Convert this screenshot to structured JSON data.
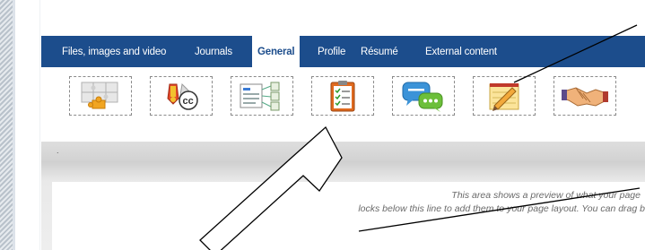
{
  "tabs": [
    {
      "label": "Files, images and video",
      "active": false
    },
    {
      "label": "Journals",
      "active": false
    },
    {
      "label": "General",
      "active": true
    },
    {
      "label": "Profile",
      "active": false
    },
    {
      "label": "Résumé",
      "active": false
    },
    {
      "label": "External content",
      "active": false
    }
  ],
  "blocks": [
    {
      "icon": "puzzle-pieces-icon"
    },
    {
      "icon": "creative-commons-license-icon"
    },
    {
      "icon": "navigation-icon"
    },
    {
      "icon": "checklist-clipboard-icon"
    },
    {
      "icon": "speech-bubbles-icon"
    },
    {
      "icon": "notepad-pencil-icon"
    },
    {
      "icon": "handshake-icon"
    }
  ],
  "divider_text": ".",
  "preview": {
    "line1": "This area shows a preview of what your page",
    "line2": "locks below this line to add them to your page layout. You can drag b"
  },
  "colors": {
    "nav_bg": "#1c4d8c",
    "nav_text": "#ffffff",
    "annotation": "#000000"
  }
}
